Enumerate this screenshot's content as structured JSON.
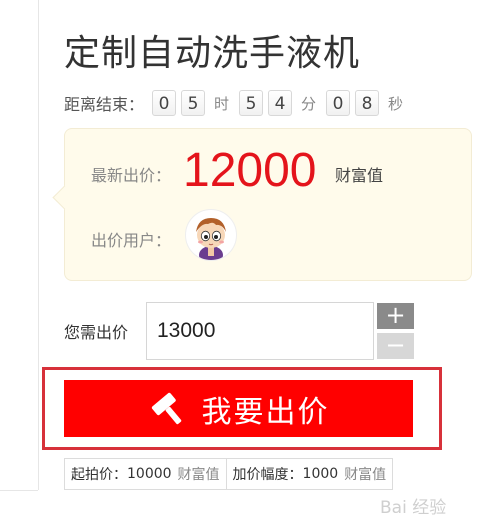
{
  "product": {
    "title": "定制自动洗手液机"
  },
  "countdown": {
    "label": "距离结束：",
    "hours": [
      "0",
      "5"
    ],
    "hours_unit": "时",
    "minutes": [
      "5",
      "4"
    ],
    "minutes_unit": "分",
    "seconds": [
      "0",
      "8"
    ],
    "seconds_unit": "秒"
  },
  "bid_panel": {
    "latest_bid_label": "最新出价：",
    "latest_bid_value": "12000",
    "latest_bid_unit": "财富值",
    "bidder_label": "出价用户："
  },
  "bid_form": {
    "your_bid_label": "您需出价",
    "input_value": "13000",
    "plus_label": "+",
    "minus_label": "−",
    "submit_label": "我要出价"
  },
  "rules": {
    "start_price_label": "起拍价：",
    "start_price_value": "10000",
    "start_price_unit": "财富值",
    "increment_label": "加价幅度：",
    "increment_value": "1000",
    "increment_unit": "财富值"
  },
  "watermark": {
    "text": "Bai 经验"
  },
  "colors": {
    "accent_red": "#ff0000",
    "price_red": "#e4141b",
    "highlight_border": "#d7313a",
    "panel_bg": "#fffbeb"
  },
  "icons": {
    "submit_icon": "gavel-icon",
    "bidder_avatar": "cartoon-avatar"
  }
}
